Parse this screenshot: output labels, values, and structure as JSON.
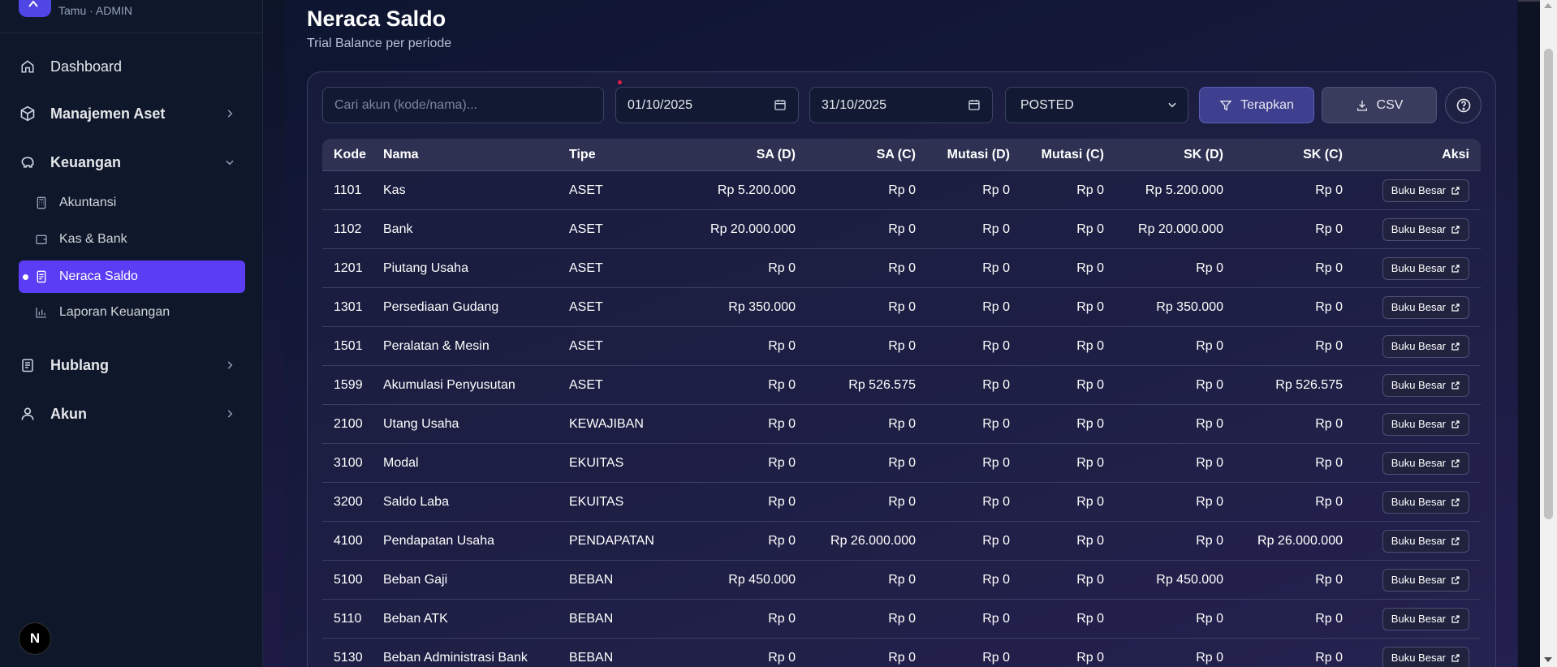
{
  "sidebar": {
    "user": "Tamu · ADMIN",
    "items": {
      "dashboard": "Dashboard",
      "manajemen_aset": "Manajemen Aset",
      "keuangan": "Keuangan",
      "akuntansi": "Akuntansi",
      "kas_bank": "Kas & Bank",
      "neraca_saldo": "Neraca Saldo",
      "laporan_keuangan": "Laporan Keuangan",
      "hublang": "Hublang",
      "akun": "Akun"
    },
    "badge": "N"
  },
  "header": {
    "title": "Neraca Saldo",
    "subtitle": "Trial Balance per periode"
  },
  "filters": {
    "search_placeholder": "Cari akun (kode/nama)...",
    "date_from": "01/10/2025",
    "date_to": "31/10/2025",
    "status": "POSTED",
    "apply_label": "Terapkan",
    "csv_label": "CSV"
  },
  "table": {
    "headers": [
      "Kode",
      "Nama",
      "Tipe",
      "SA (D)",
      "SA (C)",
      "Mutasi (D)",
      "Mutasi (C)",
      "SK (D)",
      "SK (C)",
      "Aksi"
    ],
    "action_label": "Buku Besar",
    "rows": [
      [
        "1101",
        "Kas",
        "ASET",
        "Rp 5.200.000",
        "Rp 0",
        "Rp 0",
        "Rp 0",
        "Rp 5.200.000",
        "Rp 0"
      ],
      [
        "1102",
        "Bank",
        "ASET",
        "Rp 20.000.000",
        "Rp 0",
        "Rp 0",
        "Rp 0",
        "Rp 20.000.000",
        "Rp 0"
      ],
      [
        "1201",
        "Piutang Usaha",
        "ASET",
        "Rp 0",
        "Rp 0",
        "Rp 0",
        "Rp 0",
        "Rp 0",
        "Rp 0"
      ],
      [
        "1301",
        "Persediaan Gudang",
        "ASET",
        "Rp 350.000",
        "Rp 0",
        "Rp 0",
        "Rp 0",
        "Rp 350.000",
        "Rp 0"
      ],
      [
        "1501",
        "Peralatan & Mesin",
        "ASET",
        "Rp 0",
        "Rp 0",
        "Rp 0",
        "Rp 0",
        "Rp 0",
        "Rp 0"
      ],
      [
        "1599",
        "Akumulasi Penyusutan",
        "ASET",
        "Rp 0",
        "Rp 526.575",
        "Rp 0",
        "Rp 0",
        "Rp 0",
        "Rp 526.575"
      ],
      [
        "2100",
        "Utang Usaha",
        "KEWAJIBAN",
        "Rp 0",
        "Rp 0",
        "Rp 0",
        "Rp 0",
        "Rp 0",
        "Rp 0"
      ],
      [
        "3100",
        "Modal",
        "EKUITAS",
        "Rp 0",
        "Rp 0",
        "Rp 0",
        "Rp 0",
        "Rp 0",
        "Rp 0"
      ],
      [
        "3200",
        "Saldo Laba",
        "EKUITAS",
        "Rp 0",
        "Rp 0",
        "Rp 0",
        "Rp 0",
        "Rp 0",
        "Rp 0"
      ],
      [
        "4100",
        "Pendapatan Usaha",
        "PENDAPATAN",
        "Rp 0",
        "Rp 26.000.000",
        "Rp 0",
        "Rp 0",
        "Rp 0",
        "Rp 26.000.000"
      ],
      [
        "5100",
        "Beban Gaji",
        "BEBAN",
        "Rp 450.000",
        "Rp 0",
        "Rp 0",
        "Rp 0",
        "Rp 450.000",
        "Rp 0"
      ],
      [
        "5110",
        "Beban ATK",
        "BEBAN",
        "Rp 0",
        "Rp 0",
        "Rp 0",
        "Rp 0",
        "Rp 0",
        "Rp 0"
      ],
      [
        "5130",
        "Beban Administrasi Bank",
        "BEBAN",
        "Rp 0",
        "Rp 0",
        "Rp 0",
        "Rp 0",
        "Rp 0",
        "Rp 0"
      ]
    ]
  },
  "colors": {
    "accent": "#5b3df5",
    "sidebar_bg": "#0f172a"
  }
}
